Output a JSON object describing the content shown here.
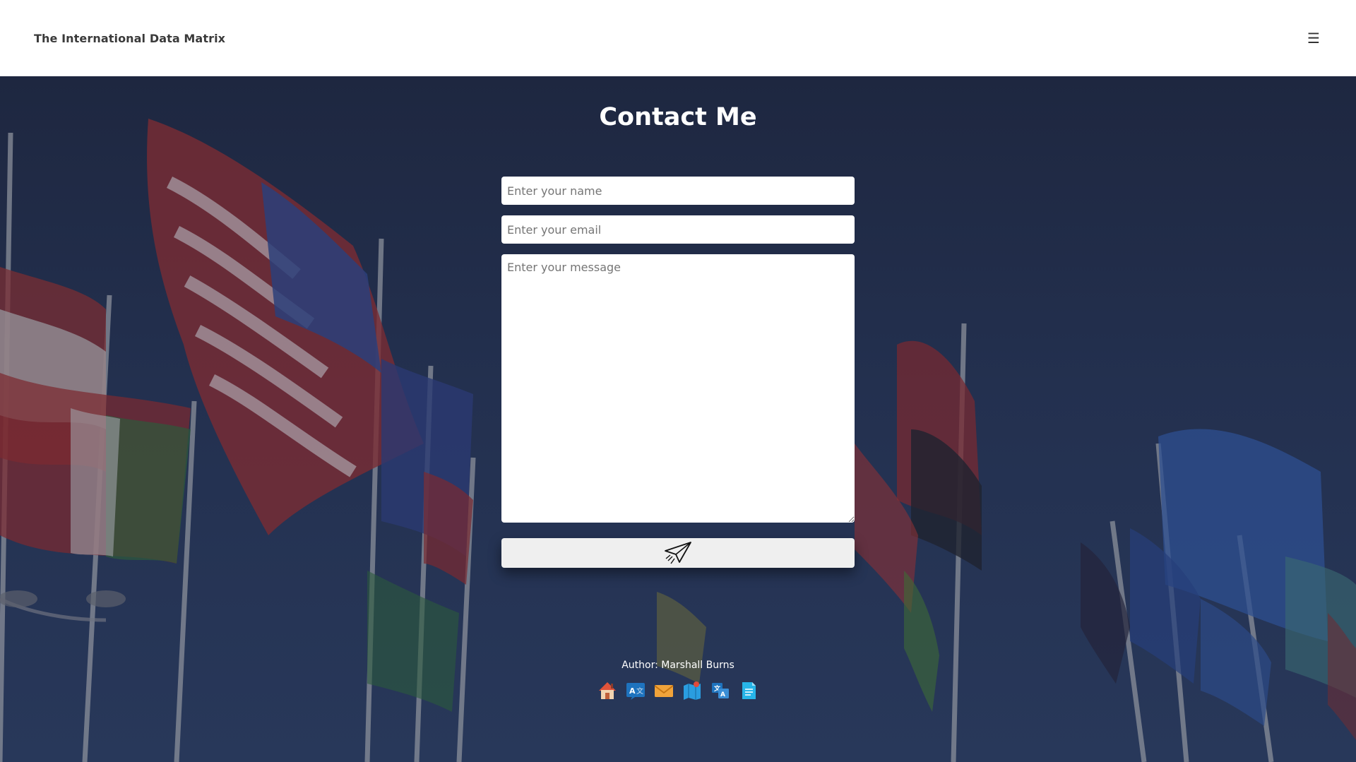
{
  "header": {
    "brand": "The International Data Matrix",
    "menu_icon": "hamburger-menu-icon",
    "menu_glyph": "☰"
  },
  "contact": {
    "title": "Contact Me",
    "name_placeholder": "Enter your name",
    "email_placeholder": "Enter your email",
    "message_placeholder": "Enter your message",
    "send_icon": "paper-plane-icon"
  },
  "footer": {
    "author": "Author: Marshall Burns",
    "icons": [
      "home-icon",
      "translate-icon",
      "email-icon",
      "map-icon",
      "language-search-icon",
      "document-icon"
    ]
  },
  "colors": {
    "header_bg": "#ffffff",
    "hero_bg": "#1f2a44",
    "button_bg": "#efefef"
  }
}
